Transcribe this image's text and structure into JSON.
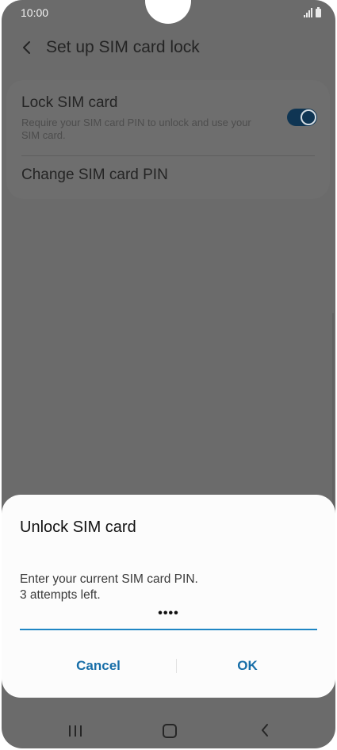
{
  "status_bar": {
    "time": "10:00",
    "icons": [
      "signal-icon",
      "battery-icon"
    ]
  },
  "header": {
    "back_icon": "chevron-left-icon",
    "title": "Set up SIM card lock"
  },
  "settings": {
    "lock_sim": {
      "title": "Lock SIM card",
      "subtitle": "Require your SIM card PIN to unlock and use your SIM card.",
      "enabled": true
    },
    "change_pin": {
      "title": "Change SIM card PIN"
    }
  },
  "dialog": {
    "title": "Unlock SIM card",
    "message_line1": "Enter your current SIM card PIN.",
    "message_line2": "3 attempts left.",
    "pin_masked": "••••",
    "cancel_label": "Cancel",
    "ok_label": "OK"
  },
  "nav_bar": {
    "icons": [
      "recents-icon",
      "home-icon",
      "back-icon"
    ]
  },
  "colors": {
    "accent": "#176ea8",
    "field_underline": "#1f86c4",
    "toggle_on": "#0f3553",
    "scrim": "#6b6b6b"
  }
}
